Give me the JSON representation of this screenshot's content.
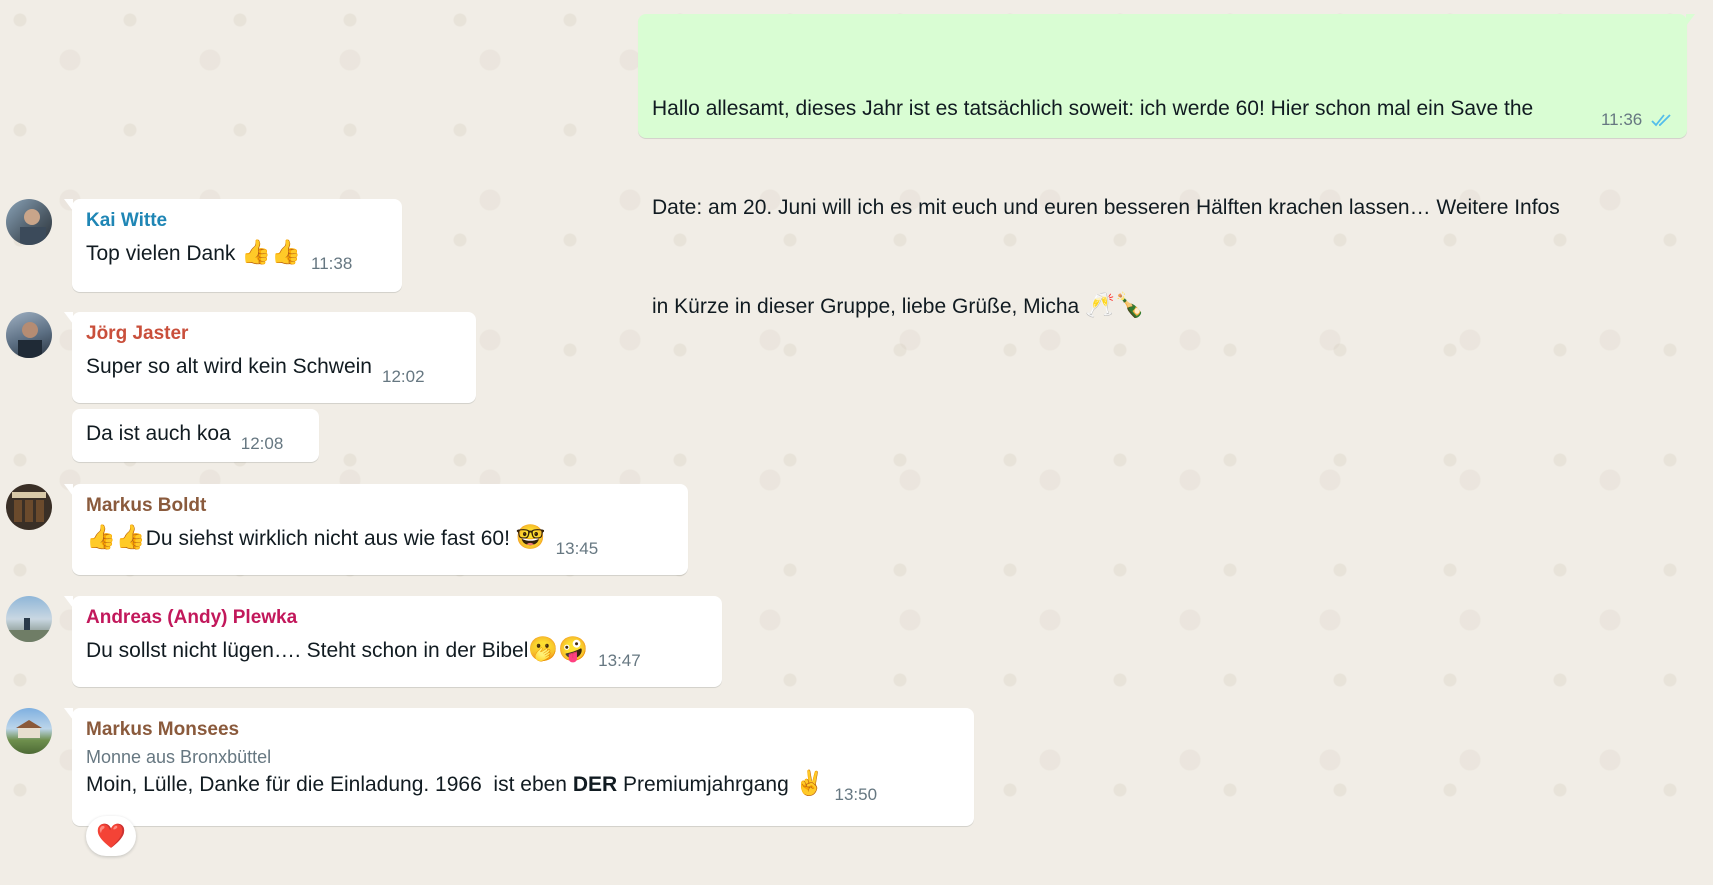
{
  "colors": {
    "background": "#efeae2",
    "incoming_bubble": "#ffffff",
    "outgoing_bubble": "#d9fdd3",
    "timestamp": "#667781",
    "read_ticks": "#53bdeb",
    "reaction_heart": "#e0242f"
  },
  "messages": [
    {
      "direction": "outgoing",
      "text_line1": "Hallo allesamt, dieses Jahr ist es tatsächlich soweit: ich werde 60! Hier schon mal ein Save the",
      "text_line2": "Date: am 20. Juni will ich es mit euch und euren besseren Hälften krachen lassen… Weitere Infos",
      "text_line3": "in Kürze in dieser Gruppe, liebe Grüße, Micha",
      "emojis": "🥂🍾",
      "time": "11:36",
      "status_icon": "double-check-read-icon"
    },
    {
      "direction": "incoming",
      "sender": "Kai Witte",
      "sender_color": "#1f86b5",
      "text": "Top vielen Dank",
      "emojis": "👍👍",
      "time": "11:38"
    },
    {
      "direction": "incoming",
      "sender": "Jörg Jaster",
      "sender_color": "#c94f3b",
      "text": "Super so alt wird kein Schwein",
      "time": "12:02"
    },
    {
      "direction": "incoming",
      "text": "Da ist auch koa",
      "time": "12:08"
    },
    {
      "direction": "incoming",
      "sender": "Markus Boldt",
      "sender_color": "#8a5a3c",
      "emojis_before": "👍👍",
      "text": "Du siehst wirklich nicht aus wie fast 60!",
      "emojis": "🤓",
      "time": "13:45"
    },
    {
      "direction": "incoming",
      "sender": "Andreas (Andy) Plewka",
      "sender_color": "#c2185b",
      "text": "Du sollst nicht lügen…. Steht schon in der Bibel",
      "emojis": "🫢🤪",
      "time": "13:47"
    },
    {
      "direction": "incoming",
      "sender": "Markus Monsees",
      "sender_color": "#8a5a3c",
      "subtitle": "Monne aus Bronxbüttel",
      "text_part1": "Moin, Lülle, Danke für die Einladung. 1966  ist eben ",
      "text_bold": "DER",
      "text_part2": " Premiumjahrgang",
      "emojis": "✌️",
      "time": "13:50",
      "reaction": "❤️"
    }
  ]
}
